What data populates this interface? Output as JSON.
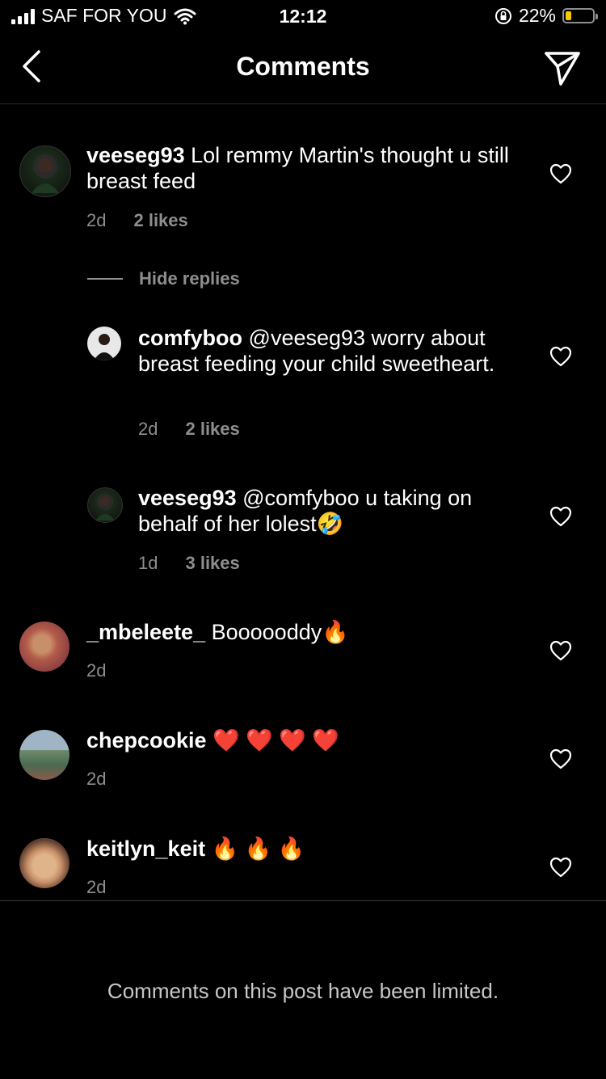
{
  "status_bar": {
    "carrier": "SAF FOR YOU",
    "time": "12:12",
    "battery_percent": "22%",
    "battery_level": 0.22,
    "battery_color": "#f5c800"
  },
  "header": {
    "title": "Comments"
  },
  "comments": [
    {
      "username": "veeseg93",
      "text": "Lol remmy Martin's thought u still breast feed",
      "time": "2d",
      "likes": "2 likes"
    }
  ],
  "replies_toggle": "Hide replies",
  "replies": [
    {
      "username": "comfyboo",
      "text": "@veeseg93 worry about breast feeding your child sweetheart.",
      "time": "2d",
      "likes": "2 likes"
    },
    {
      "username": "veeseg93",
      "text": "@comfyboo u taking on behalf of her lolest🤣",
      "time": "1d",
      "likes": "3 likes"
    }
  ],
  "more_comments": [
    {
      "username": "_mbeleete_",
      "text": "Boooooddy🔥",
      "time": "2d"
    },
    {
      "username": "chepcookie",
      "text": "❤️ ❤️ ❤️ ❤️",
      "time": "2d"
    },
    {
      "username": "keitlyn_keit",
      "text": "🔥 🔥 🔥",
      "time": "2d"
    }
  ],
  "footer": {
    "text": "Comments on this post have been limited."
  },
  "icons": [
    "back-chevron-icon",
    "send-icon",
    "heart-icon"
  ]
}
